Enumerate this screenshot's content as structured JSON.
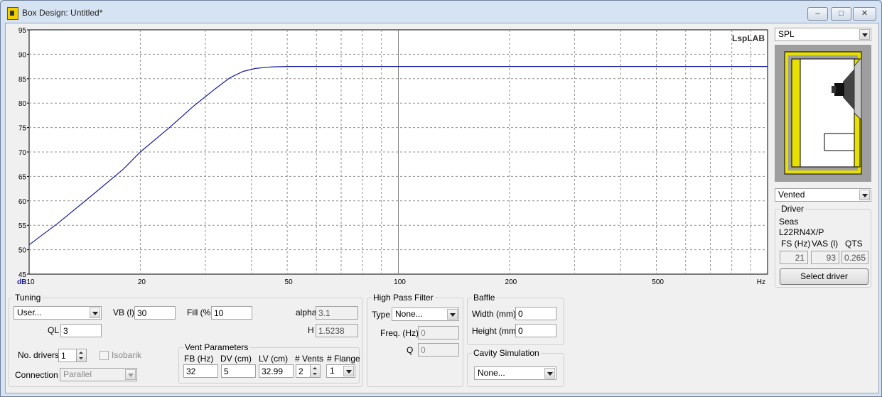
{
  "window": {
    "title": "Box Design: Untitled*"
  },
  "chart_data": {
    "type": "line",
    "x_scale": "log",
    "xlim": [
      10,
      1000
    ],
    "ylim": [
      45,
      95
    ],
    "grid": true,
    "ylabel": "dB",
    "xlabel": "Hz",
    "x_tick_labels": [
      "10",
      "20",
      "50",
      "100",
      "200",
      "500"
    ],
    "y_tick_labels": [
      "45",
      "50",
      "55",
      "60",
      "65",
      "70",
      "75",
      "80",
      "85",
      "90",
      "95"
    ],
    "watermark": "LspLAB",
    "series": [
      {
        "color": "#1a1aa0",
        "x": [
          10,
          12,
          15,
          18,
          20,
          24,
          28,
          32,
          35,
          38,
          41,
          45,
          50,
          60,
          100,
          200,
          500,
          1000
        ],
        "y": [
          51,
          55.5,
          61.5,
          66.5,
          70,
          75,
          79.5,
          83,
          85.2,
          86.5,
          87.1,
          87.4,
          87.5,
          87.5,
          87.5,
          87.5,
          87.5,
          87.5
        ]
      }
    ]
  },
  "right_panel": {
    "view_select": "SPL",
    "box_type_select": "Vented",
    "driver_group_title": "Driver",
    "driver_brand": "Seas",
    "driver_model": "L22RN4X/P",
    "fs_label": "FS (Hz)",
    "vas_label": "VAS (l)",
    "qts_label": "QTS",
    "fs_value": "21",
    "vas_value": "93",
    "qts_value": "0.265",
    "select_driver_button": "Select driver"
  },
  "tuning": {
    "group_title": "Tuning",
    "preset_select": "User...",
    "vb_label": "VB (l)",
    "vb_value": "30",
    "fill_label": "Fill (%)",
    "fill_value": "10",
    "alpha_label": "alpha",
    "alpha_value": "3.1",
    "ql_label": "QL",
    "ql_value": "3",
    "h_label": "H",
    "h_value": "1.5238",
    "no_drivers_label": "No. drivers",
    "no_drivers_value": "1",
    "isobarik_label": "Isobarik",
    "connection_label": "Connection",
    "connection_value": "Parallel"
  },
  "vent": {
    "group_title": "Vent Parameters",
    "fb_label": "FB (Hz)",
    "dv_label": "DV (cm)",
    "lv_label": "LV (cm)",
    "vents_label": "# Vents",
    "flange_label": "# Flange",
    "fb_value": "32",
    "dv_value": "5",
    "lv_value": "32.99",
    "vents_value": "2",
    "flange_value": "1"
  },
  "hpf": {
    "group_title": "High Pass Filter",
    "type_label": "Type",
    "type_value": "None...",
    "freq_label": "Freq. (Hz)",
    "freq_value": "0",
    "q_label": "Q",
    "q_value": "0"
  },
  "baffle": {
    "group_title": "Baffle",
    "width_label": "Width (mm)",
    "width_value": "0",
    "height_label": "Height (mm)",
    "height_value": "0"
  },
  "cavity": {
    "group_title": "Cavity Simulation",
    "value": "None..."
  },
  "colors": {
    "curve": "#1a1aa0",
    "box_yellow": "#e8e000",
    "box_gray": "#9e9e9e"
  }
}
